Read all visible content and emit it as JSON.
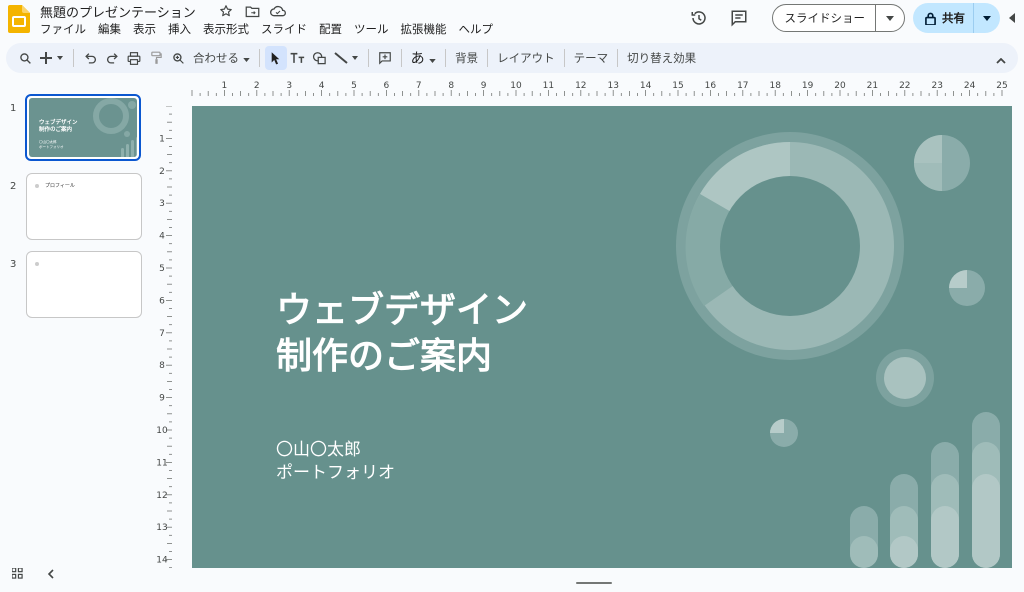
{
  "app": {
    "doc_title": "無題のプレゼンテーション",
    "menu": [
      "ファイル",
      "編集",
      "表示",
      "挿入",
      "表示形式",
      "スライド",
      "配置",
      "ツール",
      "拡張機能",
      "ヘルプ"
    ],
    "slideshow_label": "スライドショー",
    "share_label": "共有"
  },
  "toolbar": {
    "zoom_label": "合わせる",
    "ime_label": "あ",
    "background_label": "背景",
    "layout_label": "レイアウト",
    "theme_label": "テーマ",
    "transition_label": "切り替え効果"
  },
  "ruler": {
    "horizontal": [
      "1",
      "2",
      "3",
      "4",
      "5",
      "6",
      "7",
      "8",
      "9",
      "10",
      "11",
      "12",
      "13",
      "14",
      "15",
      "16",
      "17",
      "18",
      "19",
      "20",
      "21",
      "22",
      "23",
      "24",
      "25"
    ],
    "vertical": [
      "1",
      "2",
      "3",
      "4",
      "5",
      "6",
      "7",
      "8",
      "9",
      "10",
      "11",
      "12",
      "13",
      "14"
    ]
  },
  "thumbnails": [
    {
      "number": "1",
      "title": "ウェブデザイン\n制作のご案内",
      "sub": "〇山〇太郎\nポートフォリオ"
    },
    {
      "number": "2",
      "title": "プロフィール"
    },
    {
      "number": "3",
      "title": ""
    }
  ],
  "slide": {
    "title_line1": "ウェブデザイン",
    "title_line2": "制作のご案内",
    "subtitle_line1": "〇山〇太郎",
    "subtitle_line2": "ポートフォリオ",
    "background_color": "#66918d"
  },
  "colors": {
    "accent": "#0b57d0",
    "share_bg": "#c2e7ff",
    "toolbar_bg": "#edf2fa",
    "logo": "#f4b400"
  }
}
